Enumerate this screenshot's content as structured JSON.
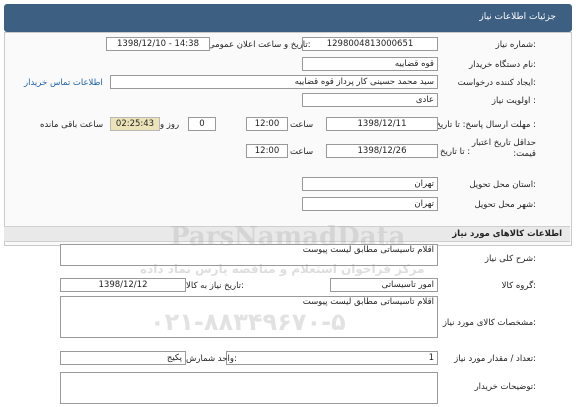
{
  "header": {
    "title": "جزئیات اطلاعات نیاز"
  },
  "need_number": {
    "label": "شماره نیاز:",
    "value": "1298004813000651"
  },
  "announce": {
    "label": "تاریخ و ساعت اعلان عمومی:",
    "value": "1398/12/10 - 14:38"
  },
  "buyer_org": {
    "label": "نام دستگاه خریدار:",
    "value": "قوه قضاییه"
  },
  "creator": {
    "label": "ایجاد کننده درخواست:",
    "value": "سید محمد حسینی کار پرداز  قوه قضاییه",
    "contact_link": "اطلاعات تماس خریدار"
  },
  "priority": {
    "label": "اولویت نیاز :",
    "value": "عادی"
  },
  "reply_deadline": {
    "label": "مهلت ارسال پاسخ: تا تاریخ :",
    "date": "1398/12/11",
    "time_label": "ساعت",
    "time": "12:00",
    "days": "0",
    "days_label": "روز و",
    "remaining": "02:25:43",
    "remaining_label": "ساعت باقی مانده"
  },
  "price_validity": {
    "label": "حداقل تاریخ اعتبار قیمت:",
    "date_label": "تا تاریخ :",
    "date": "1398/12/26",
    "time_label": "ساعت",
    "time": "12:00"
  },
  "province": {
    "label": "استان محل تحویل:",
    "value": "تهران"
  },
  "city": {
    "label": "شهر محل تحویل:",
    "value": "تهران"
  },
  "goods_section": {
    "title": "اطلاعات کالاهای مورد نیاز"
  },
  "general_desc": {
    "label": "شرح کلی نیاز:",
    "value": "اقلام تاسیساتی مطابق لیست پیوست"
  },
  "goods_group": {
    "label": "گروه کالا:",
    "value": "امور تاسیساتی",
    "need_date_label": "تاریخ نیاز به کالا:",
    "need_date": "1398/12/12"
  },
  "goods_spec": {
    "label": "مشخصات کالای مورد نیاز:",
    "value": "اقلام تاسیساتی مطابق لیست پیوست"
  },
  "quantity": {
    "label": "تعداد / مقدار مورد نیاز:",
    "value": "1",
    "unit_label": "واحد شمارش:",
    "unit": "پکیج"
  },
  "buyer_notes": {
    "label": "توضیحات خریدار:"
  },
  "watermark": {
    "line1": "ParsNamadData",
    "line2": "مرکز فراخوان استعلام و مناقصه پارس نماد داده",
    "phone": "۰۲۱-۸۸۳۴۹۶۷۰-۵"
  }
}
